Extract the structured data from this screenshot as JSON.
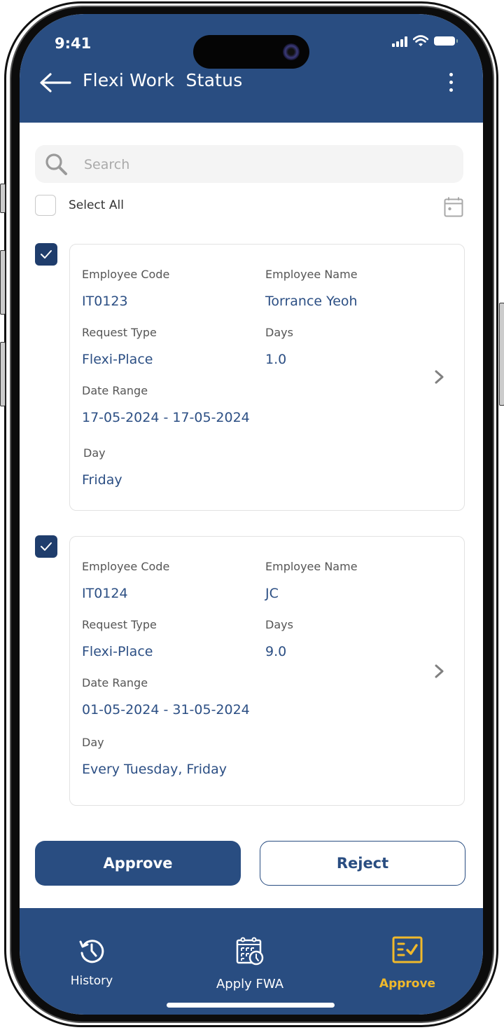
{
  "status_bar": {
    "time": "9:41"
  },
  "header": {
    "title": "Flexi Work  Status",
    "back_icon": "arrow-left-icon",
    "menu_icon": "more-vertical-icon"
  },
  "search": {
    "placeholder": "Search",
    "value": ""
  },
  "select_all": {
    "label": "Select All",
    "checked": false
  },
  "labels": {
    "employee_code": "Employee Code",
    "employee_name": "Employee Name",
    "request_type": "Request Type",
    "days": "Days",
    "date_range": "Date Range",
    "day": "Day"
  },
  "requests": [
    {
      "checked": true,
      "employee_code": "IT0123",
      "employee_name": "Torrance Yeoh",
      "request_type": "Flexi-Place",
      "days": "1.0",
      "date_range": "17-05-2024 - 17-05-2024",
      "day": "Friday"
    },
    {
      "checked": true,
      "employee_code": "IT0124",
      "employee_name": "JC",
      "request_type": "Flexi-Place",
      "days": "9.0",
      "date_range": "01-05-2024 - 31-05-2024",
      "day": "Every Tuesday, Friday"
    }
  ],
  "actions": {
    "approve": "Approve",
    "reject": "Reject"
  },
  "bottom_nav": [
    {
      "label": "History",
      "icon": "history-icon",
      "active": false
    },
    {
      "label": "Apply FWA",
      "icon": "calendar-clock-icon",
      "active": false
    },
    {
      "label": "Approve",
      "icon": "checklist-icon",
      "active": true
    }
  ],
  "colors": {
    "primary": "#294d81",
    "value_text": "#2c4f84",
    "active_nav": "#f0b92b",
    "checkbox_checked": "#1f3d6c"
  }
}
